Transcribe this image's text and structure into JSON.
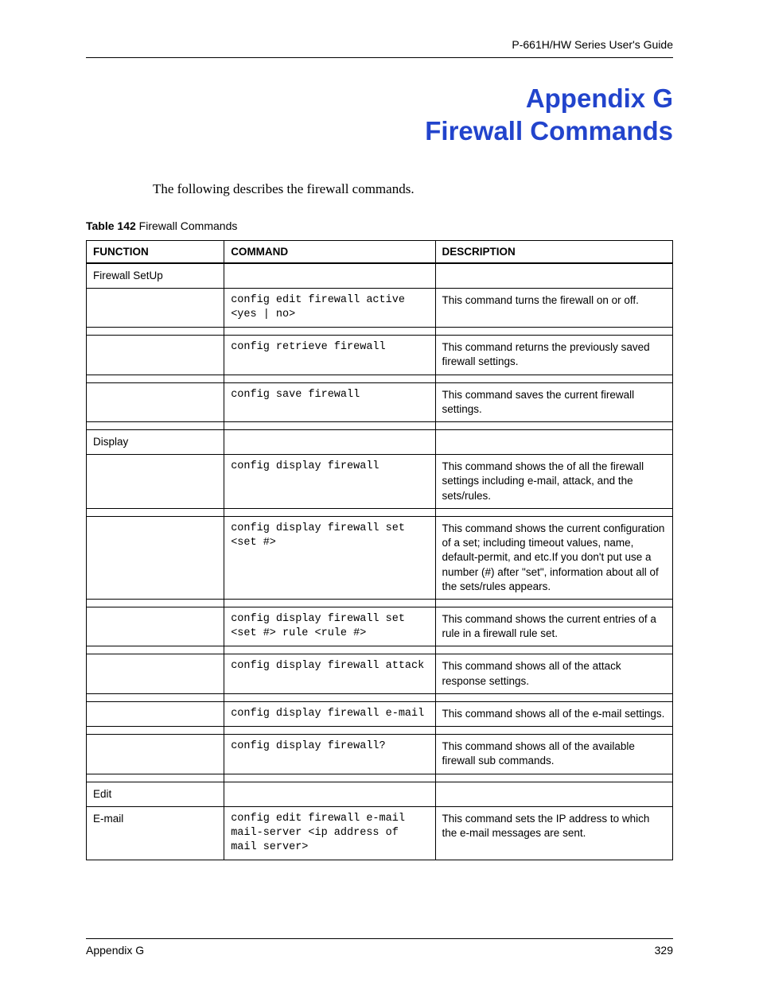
{
  "header": {
    "running": "P-661H/HW Series User's Guide"
  },
  "title": {
    "line1": "Appendix G",
    "line2": "Firewall Commands"
  },
  "intro": "The following describes the firewall commands.",
  "table": {
    "caption_bold": "Table 142",
    "caption_rest": "   Firewall Commands",
    "headers": {
      "c1": "FUNCTION",
      "c2": "COMMAND",
      "c3": "DESCRIPTION"
    },
    "rows": [
      {
        "type": "row",
        "func": "Firewall SetUp",
        "cmd": "",
        "desc": ""
      },
      {
        "type": "row",
        "func": "",
        "cmd": "config edit firewall active <yes | no>",
        "cmd_mono": true,
        "desc": "This command turns the firewall on or off."
      },
      {
        "type": "spacer"
      },
      {
        "type": "row",
        "func": "",
        "cmd": "config retrieve firewall",
        "cmd_mono": true,
        "desc": "This command returns the previously saved firewall settings."
      },
      {
        "type": "spacer"
      },
      {
        "type": "row",
        "func": "",
        "cmd": "config save firewall",
        "cmd_mono": true,
        "desc": "This command saves the current firewall settings."
      },
      {
        "type": "spacer"
      },
      {
        "type": "row",
        "func": "Display",
        "cmd": "",
        "desc": ""
      },
      {
        "type": "row",
        "func": "",
        "cmd": "config display firewall",
        "cmd_mono": true,
        "desc": "This command shows the of all the firewall settings including e-mail, attack, and the sets/rules."
      },
      {
        "type": "spacer"
      },
      {
        "type": "row",
        "func": "",
        "cmd": "config display firewall set <set #>",
        "cmd_mono": true,
        "desc": "This command shows the current configuration of a set; including timeout values, name, default-permit, and etc.If you don't put use a number (#) after \"set\", information about all of the sets/rules appears."
      },
      {
        "type": "spacer"
      },
      {
        "type": "row",
        "func": "",
        "cmd": "config display firewall set <set #> rule <rule #>",
        "cmd_mono": true,
        "desc": "This command shows the current entries of a rule in a firewall rule set."
      },
      {
        "type": "spacer"
      },
      {
        "type": "row",
        "func": "",
        "cmd": "config display firewall attack",
        "cmd_mono": true,
        "desc": "This command shows all of the attack response settings."
      },
      {
        "type": "spacer"
      },
      {
        "type": "row",
        "func": "",
        "cmd": "config display firewall e-mail",
        "cmd_mono": true,
        "desc": "This command shows all of the e-mail settings."
      },
      {
        "type": "spacer"
      },
      {
        "type": "row",
        "func": "",
        "cmd": "config display firewall?",
        "cmd_mono": true,
        "desc": "This command shows all of the available firewall sub commands."
      },
      {
        "type": "spacer"
      },
      {
        "type": "row",
        "func": "Edit",
        "cmd": "",
        "desc": ""
      },
      {
        "type": "row",
        "func": "E-mail",
        "cmd": "config edit firewall e-mail mail-server <ip address of mail server>",
        "cmd_mono": true,
        "desc": "This command sets the IP address to which the e-mail messages are sent."
      }
    ]
  },
  "footer": {
    "left": "Appendix G",
    "right": "329"
  }
}
